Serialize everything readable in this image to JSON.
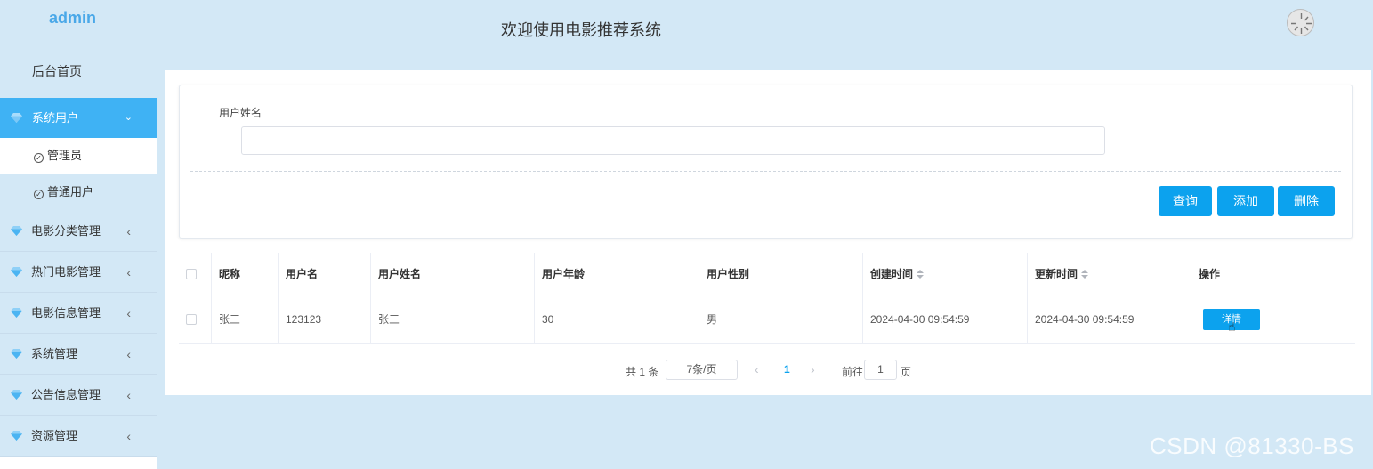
{
  "brand": "admin",
  "header": {
    "title": "欢迎使用电影推荐系统"
  },
  "sidebar": {
    "home": "后台首页",
    "active_menu": {
      "label": "系统用户",
      "icon": "diamond-icon",
      "arrow": "chevron-down-icon"
    },
    "submenu": [
      {
        "label": "管理员",
        "icon": "check-circle-icon"
      },
      {
        "label": "普通用户",
        "icon": "check-circle-icon"
      }
    ],
    "menus": [
      {
        "label": "电影分类管理",
        "icon": "diamond-icon"
      },
      {
        "label": "热门电影管理",
        "icon": "diamond-icon"
      },
      {
        "label": "电影信息管理",
        "icon": "diamond-icon"
      },
      {
        "label": "系统管理",
        "icon": "diamond-icon"
      },
      {
        "label": "公告信息管理",
        "icon": "diamond-icon"
      },
      {
        "label": "资源管理",
        "icon": "diamond-icon"
      }
    ],
    "arrow_glyph": "‹",
    "down_glyph": "⌄"
  },
  "search": {
    "label": "用户姓名",
    "value": "",
    "placeholder": ""
  },
  "buttons": {
    "query": "查询",
    "add": "添加",
    "delete": "删除"
  },
  "table": {
    "columns": [
      "昵称",
      "用户名",
      "用户姓名",
      "用户年龄",
      "用户性别",
      "创建时间",
      "更新时间",
      "操作"
    ],
    "rows": [
      {
        "nickname": "张三",
        "username": "123123",
        "name": "张三",
        "age": "30",
        "gender": "男",
        "created": "2024-04-30 09:54:59",
        "updated": "2024-04-30 09:54:59",
        "action": "详情"
      }
    ]
  },
  "pagination": {
    "total": "共 1 条",
    "page_size": "7条/页",
    "current": "1",
    "goto_label": "前往",
    "goto_value": "1",
    "unit": "页"
  },
  "watermark": "CSDN @81330-BS",
  "colors": {
    "accent": "#0ca2ee",
    "sidebar_active": "#3fb2f4",
    "background": "#d3e8f6",
    "brand": "#4aa8e8"
  }
}
